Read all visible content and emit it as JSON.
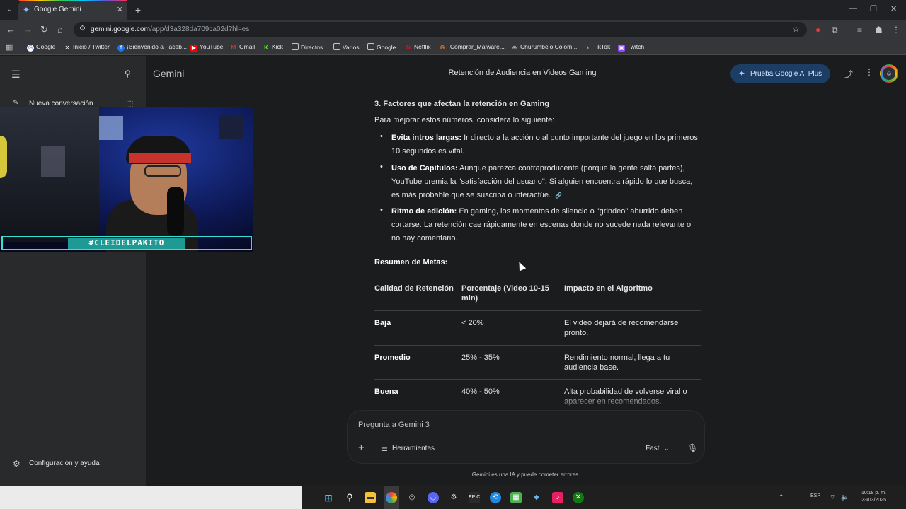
{
  "browser": {
    "tab_title": "Google Gemini",
    "url_host": "gemini.google.com",
    "url_path": "/app/d3a328da709ca02d?hl=es",
    "bookmarks": [
      "Google",
      "Inicio / Twitter",
      "¡Bienvenido a Faceb...",
      "YouTube",
      "Gmail",
      "Kick",
      "Directos",
      "Varios",
      "Google",
      "Netflix",
      "¡Comprar_Malware...",
      "Churumbelo Colom...",
      "TikTok",
      "Twitch"
    ]
  },
  "sidebar": {
    "new_chat": "Nueva conversación",
    "settings": "Configuración y ayuda"
  },
  "webcam": {
    "tag": "#CLEIDELPAKITO"
  },
  "header": {
    "brand": "Gemini",
    "conversation_title": "Retención de Audiencia en Videos Gaming",
    "upgrade_button": "Prueba Google AI Plus"
  },
  "response": {
    "section_title": "3. Factores que afectan la retención en Gaming",
    "intro": "Para mejorar estos números, considera lo siguiente:",
    "bullets": [
      {
        "bold": "Evita intros largas:",
        "text": " Ir directo a la acción o al punto importante del juego en los primeros 10 segundos es vital."
      },
      {
        "bold": "Uso de Capítulos:",
        "text": " Aunque parezca contraproducente (porque la gente salta partes), YouTube premia la \"satisfacción del usuario\". Si alguien encuentra rápido lo que busca, es más probable que se suscriba o interactúe."
      },
      {
        "bold": "Ritmo de edición:",
        "text": " En gaming, los momentos de silencio o \"grindeo\" aburrido deben cortarse. La retención cae rápidamente en escenas donde no sucede nada relevante o no hay comentario."
      }
    ],
    "summary_title": "Resumen de Metas:",
    "table": {
      "headers": [
        "Calidad de Retención",
        "Porcentaje (Video 10-15 min)",
        "Impacto en el Algoritmo"
      ],
      "rows": [
        [
          "Baja",
          "< 20%",
          "El video dejará de recomendarse pronto."
        ],
        [
          "Promedio",
          "25% - 35%",
          "Rendimiento normal, llega a tu audiencia base."
        ],
        [
          "Buena",
          "40% - 50%",
          "Alta probabilidad de volverse viral o aparecer en recomendados."
        ]
      ]
    }
  },
  "prompt": {
    "placeholder": "Pregunta a Gemini 3",
    "tools": "Herramientas",
    "model": "Fast",
    "disclaimer": "Gemini es una IA y puede cometer errores."
  },
  "taskbar": {
    "lang": "ESP",
    "time": "10:18 p. m.",
    "date": "23/03/2025"
  }
}
